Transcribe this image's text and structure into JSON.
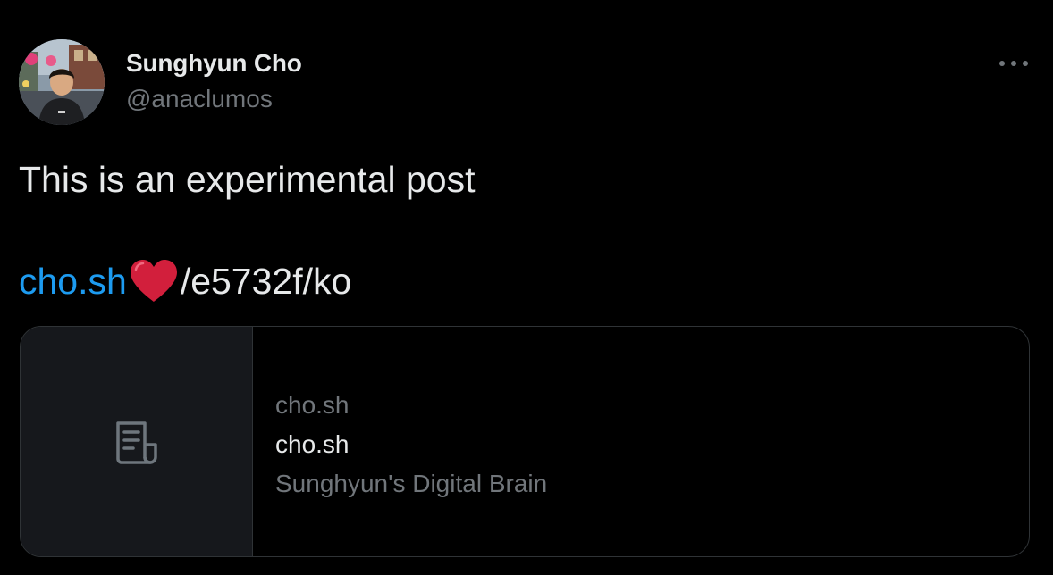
{
  "author": {
    "name": "Sunghyun Cho",
    "handle": "@anaclumos"
  },
  "tweet": {
    "text": "This is an experimental post",
    "link_domain": "cho.sh",
    "link_path": "/e5732f/ko"
  },
  "card": {
    "domain": "cho.sh",
    "title": "cho.sh",
    "description": "Sunghyun's Digital Brain"
  },
  "icons": {
    "more": "more-horizontal-icon",
    "heart": "red-heart-icon",
    "document": "document-icon"
  },
  "colors": {
    "background": "#000000",
    "text": "#e7e9ea",
    "secondary_text": "#71767b",
    "link": "#1d9bf0",
    "heart": "#d21f3c",
    "card_border": "#2f3336",
    "card_media_bg": "#16181c"
  }
}
